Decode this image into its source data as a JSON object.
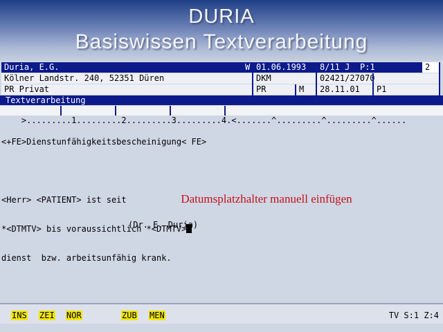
{
  "banner": {
    "title": "DURIA",
    "subtitle": "Basiswissen Textverarbeitung"
  },
  "patient": {
    "name": "Duria, E.G.",
    "flag": "W",
    "birthdate": "01.06.1993",
    "age": "8/11 J",
    "p_number": "P:1",
    "count": "2",
    "address": "Kölner Landstr. 240, 52351 Düren",
    "insurance": "DKM",
    "phone": "02421/27070",
    "status": "PR Privat",
    "status_code": "PR",
    "sex": "M",
    "date": "28.11.01",
    "p_code": "P1"
  },
  "editor": {
    "title": "Textverarbeitung",
    "ruler": ">.........1.........2.........3.........4.<.......^.........^.........^......",
    "lines": [
      "<+FE>Dienstunfähigkeitsbescheinigung< FE>",
      "",
      "<Herr> <PATIENT> ist seit",
      "*<DTMTV> bis voraussichtlich *<DTMTV>",
      "dienst  bzw. arbeitsunfähig krank."
    ],
    "hint": "Datumsplatzhalter manuell einfügen",
    "signature": "(Dr. E. Duria)"
  },
  "status": {
    "keys": [
      "INS",
      "ZEI",
      "NOR",
      "ZUB",
      "MEN"
    ],
    "mode": "TV S:1 Z:4"
  },
  "colors": {
    "header_blue": "#0c1a8a",
    "screen_bg": "#cfd6e4",
    "fkey_yellow": "#f2e600",
    "hint_red": "#c3121a"
  }
}
